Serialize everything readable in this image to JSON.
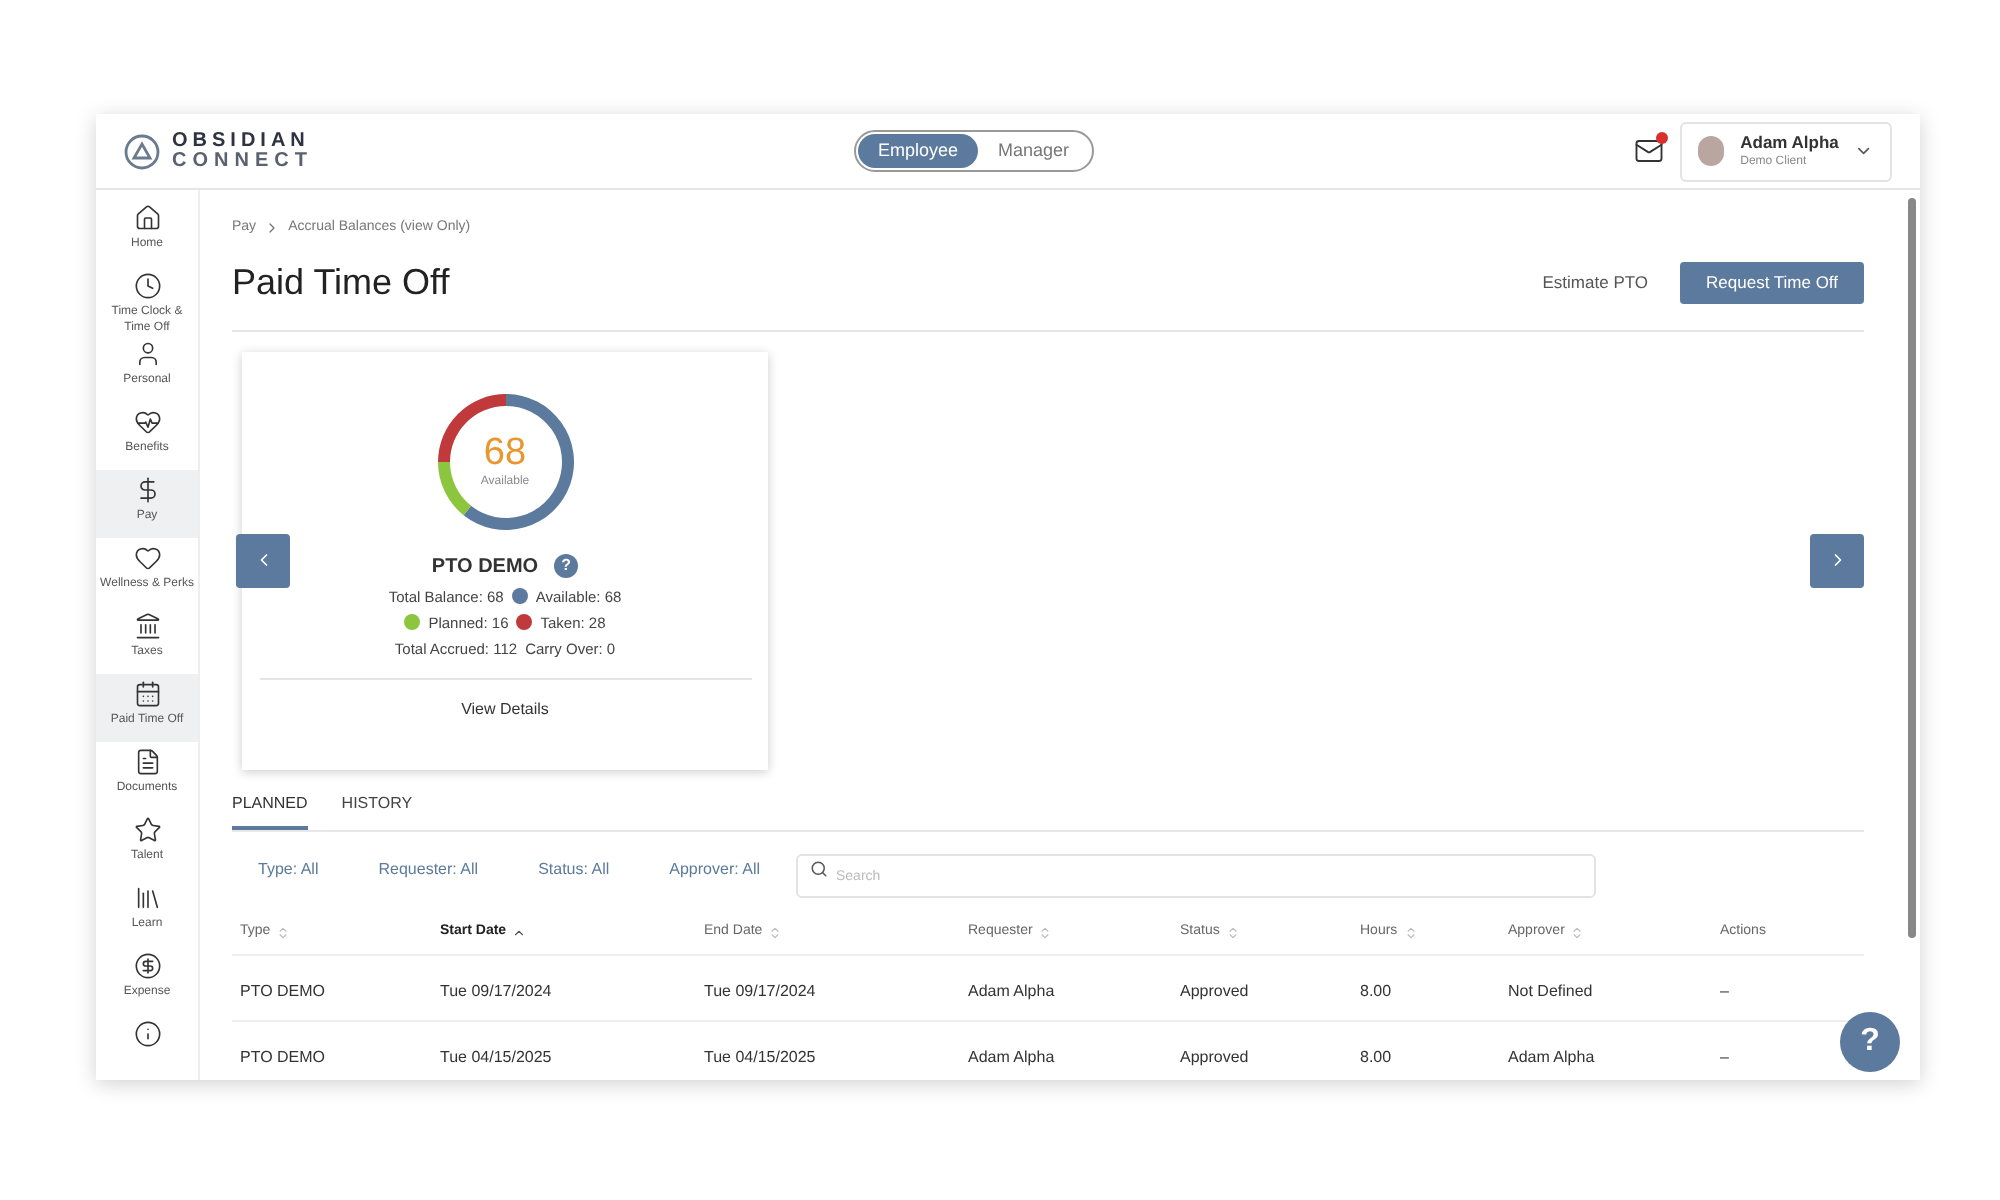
{
  "header": {
    "logo": {
      "line1": "OBSIDIAN",
      "line2": "CONNECT"
    },
    "roles": [
      {
        "label": "Employee",
        "selected": true
      },
      {
        "label": "Manager",
        "selected": false
      }
    ],
    "mail": {
      "unread": true
    },
    "user": {
      "name": "Adam Alpha",
      "client": "Demo Client"
    }
  },
  "sidebar": {
    "items": [
      {
        "label": "Home",
        "selected": false
      },
      {
        "label": "Time Clock & Time Off",
        "selected": false
      },
      {
        "label": "Personal",
        "selected": false
      },
      {
        "label": "Benefits",
        "selected": false
      },
      {
        "label": "Pay",
        "selected": true
      },
      {
        "label": "Wellness & Perks",
        "selected": false
      },
      {
        "label": "Taxes",
        "selected": false
      },
      {
        "label": "Paid Time Off",
        "selected": true
      },
      {
        "label": "Documents",
        "selected": false
      },
      {
        "label": "Talent",
        "selected": false
      },
      {
        "label": "Learn",
        "selected": false
      },
      {
        "label": "Expense",
        "selected": false
      },
      {
        "selected": false
      }
    ]
  },
  "breadcrumb": [
    "Pay",
    "Accrual Balances (view Only)"
  ],
  "title": "Paid Time Off",
  "actions": {
    "estimate": "Estimate PTO",
    "request": "Request Time Off"
  },
  "card": {
    "center_value": "68",
    "center_label": "Available",
    "help": "?",
    "chart_data": {
      "type": "donut",
      "categories": [
        "Available: 68",
        "Planned: 16",
        "Taken: 28"
      ],
      "series": [
        {
          "name": "PTO DEMO",
          "values": [
            68,
            16,
            28
          ]
        }
      ]
    },
    "legend": [
      {
        "color": "#5b7a9d"
      },
      {
        "color": "#8cc63f"
      },
      {
        "color": "#c0393b"
      }
    ],
    "totals": [
      "Total Balance: 68",
      "Total Accrued: 112",
      "Carry Over: 0"
    ],
    "link": "View Details"
  },
  "tabs": [
    {
      "label": "PLANNED",
      "selected": true
    },
    {
      "label": "HISTORY",
      "selected": false
    }
  ],
  "filters": [
    "Type: All",
    "Requester: All",
    "Status: All",
    "Approver: All"
  ],
  "search": {
    "placeholder": "Search"
  },
  "table": {
    "columns": [
      {
        "label": "Type",
        "kind": "sortable"
      },
      {
        "label": "Start Date",
        "kind": "sorted"
      },
      {
        "label": "End Date",
        "kind": "sortable"
      },
      {
        "label": "Requester",
        "kind": "sortable"
      },
      {
        "label": "Status",
        "kind": "sortable"
      },
      {
        "label": "Hours",
        "kind": "sortable"
      },
      {
        "label": "Approver",
        "kind": "sortable"
      },
      {
        "label": "Actions",
        "kind": "plain"
      }
    ],
    "rows": [
      [
        "PTO DEMO",
        "Tue 09/17/2024",
        "Tue 09/17/2024",
        "Adam Alpha",
        "Approved",
        "8.00",
        "Not Defined",
        "–"
      ],
      [
        "PTO DEMO",
        "Tue 04/15/2025",
        "Tue 04/15/2025",
        "Adam Alpha",
        "Approved",
        "8.00",
        "Adam Alpha",
        "–"
      ]
    ]
  },
  "help": "?"
}
